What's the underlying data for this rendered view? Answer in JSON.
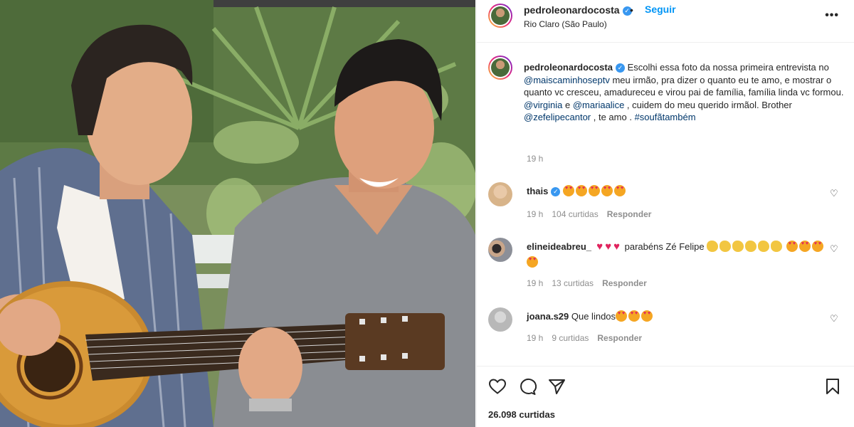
{
  "header": {
    "username": "pedroleonardocosta",
    "separator": "•",
    "follow_label": "Seguir",
    "location": "Rio Claro (São Paulo)",
    "more_label": "•••"
  },
  "caption": {
    "username": "pedroleonardocosta",
    "text_1": " Escolhi essa foto da nossa primeira entrevista no ",
    "mention_1": "@maiscaminhoseptv",
    "text_2": " meu irmão, pra dizer o quanto eu te amo, e mostrar o quanto vc cresceu, amadureceu e virou pai de família, família linda vc formou. ",
    "mention_2": "@virginia",
    "text_3": " e ",
    "mention_3": "@mariaalice",
    "text_4": " , cuidem do meu querido irmãol. Brother ",
    "mention_4": "@zefelipecantor",
    "text_5": " , te amo . ",
    "hashtag": "#soufãtambém",
    "time": "19 h"
  },
  "comments": [
    {
      "username": "thais",
      "verified": true,
      "text": " ",
      "time": "19 h",
      "likes": "104 curtidas",
      "reply": "Responder"
    },
    {
      "username": "elineideabreu_",
      "verified": false,
      "text": " parabéns Zé Felipe ",
      "time": "19 h",
      "likes": "13 curtidas",
      "reply": "Responder"
    },
    {
      "username": "joana.s29",
      "verified": false,
      "text": " Que lindos",
      "time": "19 h",
      "likes": "9 curtidas",
      "reply": "Responder"
    }
  ],
  "footer": {
    "likes": "26.098 curtidas"
  },
  "icons": {
    "like": "heart-icon",
    "comment": "comment-icon",
    "share": "send-icon",
    "save": "bookmark-icon",
    "verified": "verified-badge-icon",
    "more": "more-options-icon"
  },
  "colors": {
    "link": "#00376b",
    "follow": "#0095f6",
    "verified": "#3897f0",
    "muted": "#8e8e8e"
  }
}
